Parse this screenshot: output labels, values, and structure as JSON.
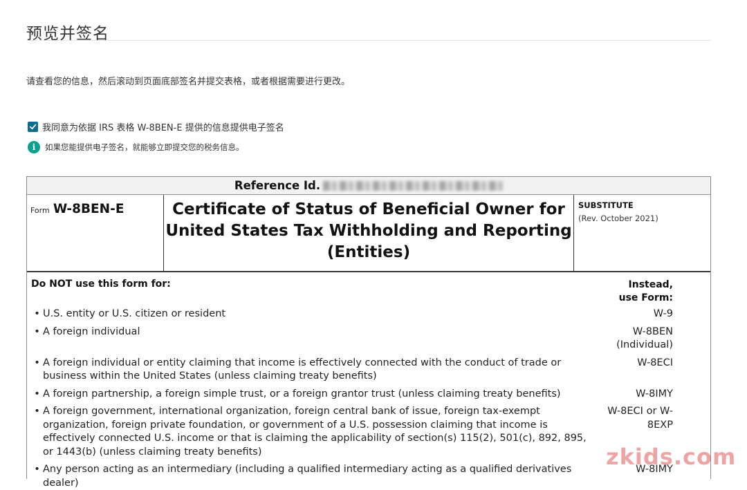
{
  "page": {
    "title": "预览并签名",
    "intro": "请查看您的信息，然后滚动到页面底部签名并提交表格，或者根据需要进行更改。",
    "consent_label": "我同意为依据 IRS 表格 W-8BEN-E 提供的信息提供电子签名",
    "consent_checked": true,
    "info_text": "如果您能提供电子签名，就能够立即提交您的税务信息。"
  },
  "form": {
    "reference_label": "Reference Id.",
    "form_prefix": "Form",
    "form_number": "W-8BEN-E",
    "title": "Certificate of Status of Beneficial Owner for United States Tax Withholding and Reporting (Entities)",
    "substitute": "SUBSTITUTE",
    "revision": "(Rev. October 2021)",
    "do_not_use": "Do NOT use this form for:",
    "instead_use": "Instead, use Form:",
    "rows": [
      {
        "desc": "U.S. entity or U.S. citizen or resident",
        "form": "W-9"
      },
      {
        "desc": "A foreign individual",
        "form": "W-8BEN (Individual)"
      },
      {
        "desc": "A foreign individual or entity claiming that income is effectively connected with the conduct of trade or business within the United States (unless claiming treaty benefits)",
        "form": "W-8ECI"
      },
      {
        "desc": "A foreign partnership, a foreign simple trust, or a foreign grantor trust (unless claiming treaty benefits)",
        "form": "W-8IMY"
      },
      {
        "desc": "A foreign government, international organization, foreign central bank of issue, foreign tax-exempt organization, foreign private foundation, or government of a U.S. possession claiming that income is effectively connected U.S. income or that is claiming the applicability of section(s) 115(2), 501(c), 892, 895, or 1443(b) (unless claiming treaty benefits)",
        "form": "W-8ECI or W-8EXP"
      },
      {
        "desc": "Any person acting as an intermediary (including a qualified intermediary acting as a qualified derivatives dealer)",
        "form": "W-8IMY"
      }
    ]
  },
  "watermark": "zkids.com",
  "colors": {
    "checkbox": "#0f6c8c",
    "info_icon": "#0aa18c",
    "watermark": "#e05a5a"
  }
}
